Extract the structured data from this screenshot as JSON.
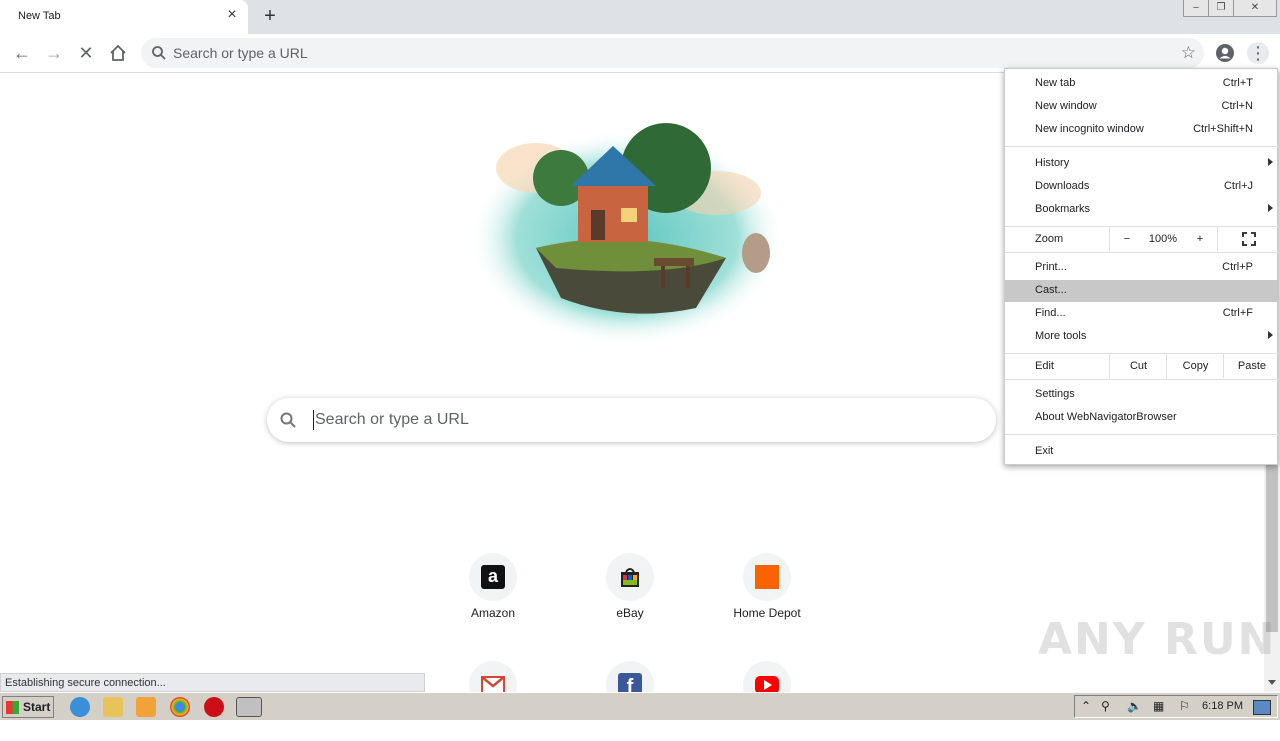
{
  "tab": {
    "title": "New Tab"
  },
  "omnibox": {
    "placeholder": "Search or type a URL"
  },
  "ntp": {
    "search_placeholder": "Search or type a URL",
    "tiles": [
      {
        "label": "Amazon",
        "icon": "amazon-icon"
      },
      {
        "label": "eBay",
        "icon": "ebay-icon"
      },
      {
        "label": "Home Depot",
        "icon": "home-depot-icon"
      },
      {
        "label": "",
        "icon": "gmail-icon"
      },
      {
        "label": "",
        "icon": "facebook-icon"
      },
      {
        "label": "",
        "icon": "youtube-icon"
      }
    ]
  },
  "menu": {
    "new_tab": {
      "label": "New tab",
      "shortcut": "Ctrl+T"
    },
    "new_window": {
      "label": "New window",
      "shortcut": "Ctrl+N"
    },
    "new_incognito": {
      "label": "New incognito window",
      "shortcut": "Ctrl+Shift+N"
    },
    "history": {
      "label": "History"
    },
    "downloads": {
      "label": "Downloads",
      "shortcut": "Ctrl+J"
    },
    "bookmarks": {
      "label": "Bookmarks"
    },
    "zoom": {
      "label": "Zoom",
      "minus": "−",
      "value": "100%",
      "plus": "+"
    },
    "print": {
      "label": "Print...",
      "shortcut": "Ctrl+P"
    },
    "cast": {
      "label": "Cast..."
    },
    "find": {
      "label": "Find...",
      "shortcut": "Ctrl+F"
    },
    "more_tools": {
      "label": "More tools"
    },
    "edit": {
      "label": "Edit",
      "cut": "Cut",
      "copy": "Copy",
      "paste": "Paste"
    },
    "settings": {
      "label": "Settings"
    },
    "about": {
      "label": "About WebNavigatorBrowser"
    },
    "exit": {
      "label": "Exit"
    }
  },
  "status": {
    "text": "Establishing secure connection..."
  },
  "watermark": {
    "text": "ANY RUN"
  },
  "taskbar": {
    "start_label": "Start",
    "clock": "6:18 PM"
  },
  "colors": {
    "accent": "#1a73e8",
    "menu_highlight": "#c8c8c8",
    "taskbar": "#d4d0c8"
  }
}
